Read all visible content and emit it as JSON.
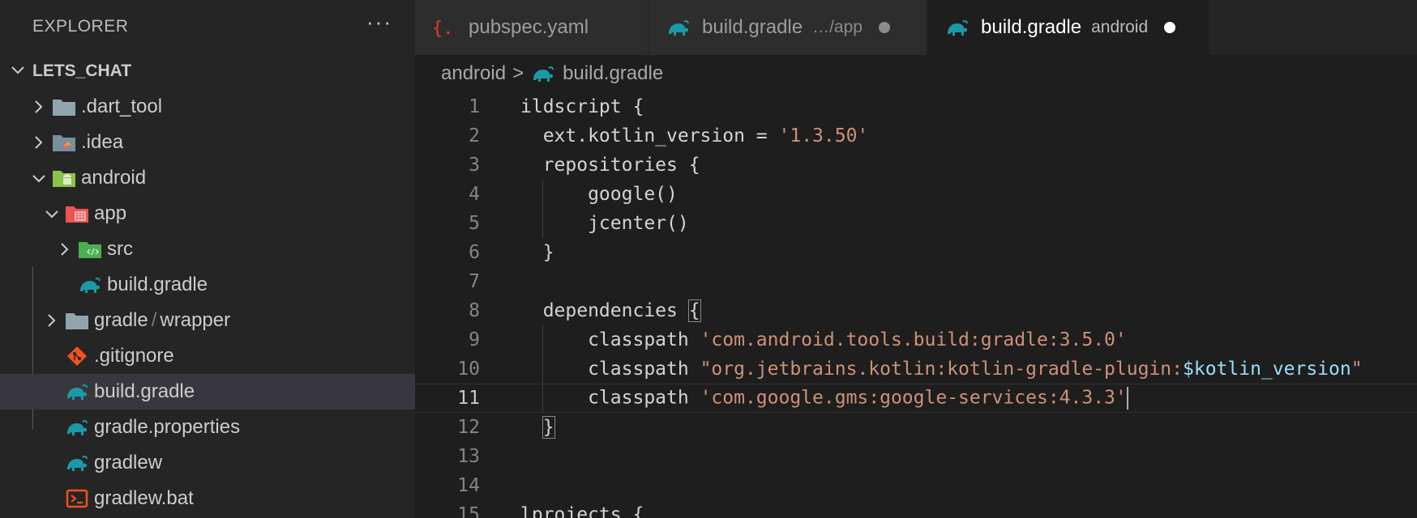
{
  "explorer": {
    "title": "EXPLORER",
    "more": "···",
    "section": "LETS_CHAT",
    "items": [
      {
        "label": ".dart_tool",
        "icon": "folder-icon"
      },
      {
        "label": ".idea",
        "icon": "idea-folder-icon"
      },
      {
        "label": "android",
        "icon": "android-folder-icon"
      },
      {
        "label": "app",
        "icon": "app-folder-icon"
      },
      {
        "label": "src",
        "icon": "src-folder-icon"
      },
      {
        "label": "build.gradle",
        "icon": "gradle-icon"
      },
      {
        "label": "gradle",
        "label2": "wrapper",
        "separator": "/",
        "icon": "folder-icon"
      },
      {
        "label": ".gitignore",
        "icon": "git-icon"
      },
      {
        "label": "build.gradle",
        "icon": "gradle-icon"
      },
      {
        "label": "gradle.properties",
        "icon": "gradle-icon"
      },
      {
        "label": "gradlew",
        "icon": "gradle-icon"
      },
      {
        "label": "gradlew.bat",
        "icon": "terminal-icon"
      }
    ]
  },
  "tabs": [
    {
      "label": "pubspec.yaml",
      "icon": "yaml-braces-icon"
    },
    {
      "label": "build.gradle",
      "desc": "…/app",
      "icon": "gradle-icon"
    },
    {
      "label": "build.gradle",
      "desc": "android",
      "icon": "gradle-icon"
    }
  ],
  "breadcrumb": {
    "folder": "android",
    "separator": ">",
    "file": "build.gradle"
  },
  "editor": {
    "line_numbers": [
      "1",
      "2",
      "3",
      "4",
      "5",
      "6",
      "7",
      "8",
      "9",
      "10",
      "11",
      "12",
      "13",
      "14",
      "15"
    ],
    "lines": {
      "l1": "ildscript {",
      "l2a": "  ext.kotlin_version = ",
      "l2b": "'1.3.50'",
      "l3": "  repositories {",
      "l4": "      google()",
      "l5": "      jcenter()",
      "l6": "  }",
      "l8a": "  dependencies ",
      "l8b": "{",
      "l9a": "      classpath ",
      "l9b": "'com.android.tools.build:gradle:3.5.0'",
      "l10a": "      classpath ",
      "l10b": "\"org.jetbrains.kotlin:kotlin-gradle-plugin:",
      "l10c": "$kotlin_version",
      "l10d": "\"",
      "l11a": "      classpath ",
      "l11b": "'com.google.gms:google-services:4.3.3'",
      "l12a": "  ",
      "l12b": "}",
      "l15": "lprojects {"
    }
  },
  "colors": {
    "string": "#ce9178",
    "variable": "#9cdcfe",
    "gradle": "#1a9aa8",
    "folder": "#90a4ae"
  }
}
